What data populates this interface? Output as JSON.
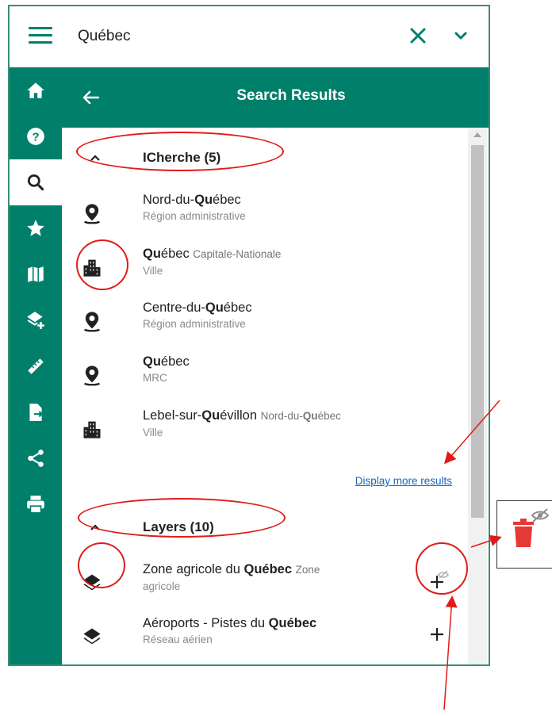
{
  "search": {
    "value": "Québec"
  },
  "panel": {
    "title": "Search Results"
  },
  "groups": [
    {
      "title": "ICherche (5)"
    },
    {
      "title": "Layers (10)"
    }
  ],
  "results": [
    {
      "pre": "Nord-du-",
      "bold": "Qu",
      "post": "ébec",
      "inline_sub": "",
      "sub": "Région administrative",
      "icon": "map-pin-icon"
    },
    {
      "pre": "",
      "bold": "Qu",
      "post": "ébec",
      "inline_sub": "Capitale-Nationale",
      "sub": "Ville",
      "icon": "city-icon"
    },
    {
      "pre": "Centre-du-",
      "bold": "Qu",
      "post": "ébec",
      "inline_sub": "",
      "sub": "Région administrative",
      "icon": "map-pin-icon"
    },
    {
      "pre": "",
      "bold": "Qu",
      "post": "ébec",
      "inline_sub": "",
      "sub": "MRC",
      "icon": "map-pin-icon"
    },
    {
      "pre": "Lebel-sur-",
      "bold": "Qu",
      "post": "évillon",
      "inline_sub_pre": "Nord-du-",
      "inline_sub_bold": "Qu",
      "inline_sub_post": "ébec",
      "sub": "Ville",
      "icon": "city-icon"
    }
  ],
  "more_results_label": "Display more results",
  "layers": [
    {
      "pre": "Zone agricole du ",
      "bold": "Québec",
      "inline_sub": "Zone",
      "sub": "agricole",
      "icon": "layers-icon"
    },
    {
      "pre": "Aéroports - Pistes du ",
      "bold": "Québec",
      "inline_sub": "",
      "sub": "Réseau aérien",
      "icon": "layers-icon"
    }
  ],
  "colors": {
    "primary": "#00806b",
    "annotation": "#e01b1b",
    "link": "#1565c0",
    "delete": "#e53935"
  }
}
